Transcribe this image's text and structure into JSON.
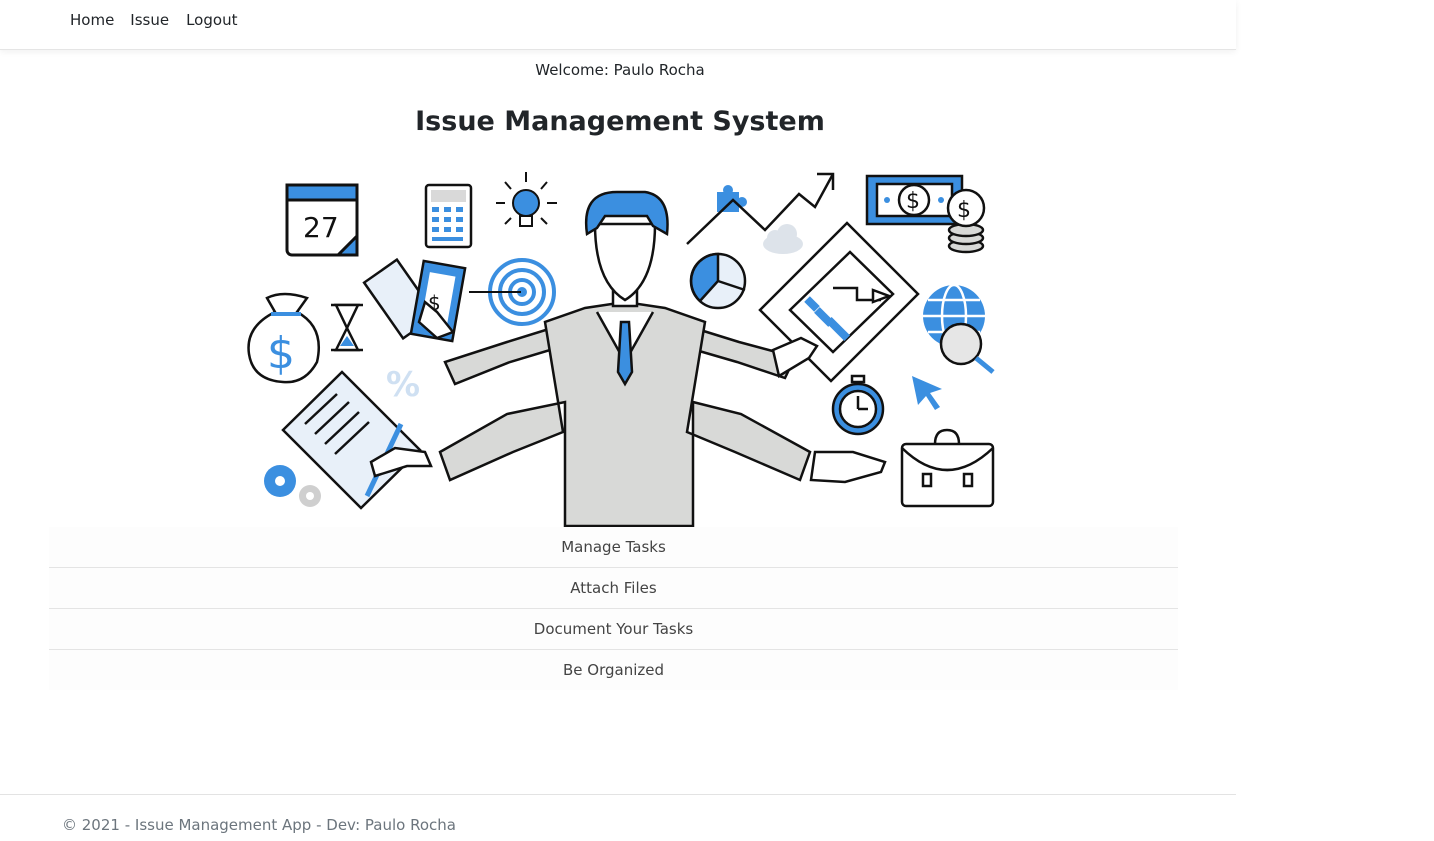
{
  "nav": {
    "items": [
      "Home",
      "Issue",
      "Logout"
    ]
  },
  "welcome": "Welcome: Paulo Rocha",
  "page_title": "Issue Management System",
  "hero": {
    "calendar_day": "27",
    "percent": "%",
    "dollar": "$"
  },
  "features": [
    "Manage Tasks",
    "Attach Files",
    "Document Your Tasks",
    "Be Organized"
  ],
  "footer": "© 2021 - Issue Management App - Dev: Paulo Rocha",
  "colors": {
    "accent": "#3b8fe0",
    "figure_body": "#d8d9d7",
    "line": "#111111"
  }
}
